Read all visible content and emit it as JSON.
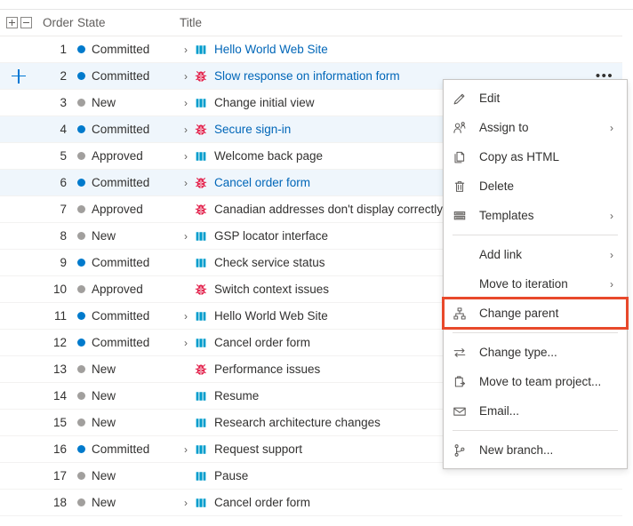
{
  "grid": {
    "columns": {
      "toggle_expand_label": "expand-all",
      "toggle_collapse_label": "collapse-all",
      "order": "Order",
      "state": "State",
      "title": "Title"
    },
    "more_glyph": "•••",
    "chevron_glyph": "›",
    "rows": [
      {
        "order": "1",
        "state": "Committed",
        "state_color": "#007acc",
        "chevron": true,
        "icon": "backlog-item-icon",
        "title": "Hello World Web Site",
        "link": true,
        "selected": false,
        "more": false,
        "addchild": false
      },
      {
        "order": "2",
        "state": "Committed",
        "state_color": "#007acc",
        "chevron": true,
        "icon": "bug-icon",
        "title": "Slow response on information form",
        "link": true,
        "selected": true,
        "more": true,
        "addchild": true
      },
      {
        "order": "3",
        "state": "New",
        "state_color": "#a19f9d",
        "chevron": true,
        "icon": "backlog-item-icon",
        "title": "Change initial view",
        "link": false,
        "selected": false,
        "more": false,
        "addchild": false
      },
      {
        "order": "4",
        "state": "Committed",
        "state_color": "#007acc",
        "chevron": true,
        "icon": "bug-icon",
        "title": "Secure sign-in",
        "link": true,
        "selected": true,
        "more": true,
        "addchild": false
      },
      {
        "order": "5",
        "state": "Approved",
        "state_color": "#a19f9d",
        "chevron": true,
        "icon": "backlog-item-icon",
        "title": "Welcome back page",
        "link": false,
        "selected": false,
        "more": false,
        "addchild": false
      },
      {
        "order": "6",
        "state": "Committed",
        "state_color": "#007acc",
        "chevron": true,
        "icon": "bug-icon",
        "title": "Cancel order form",
        "link": true,
        "selected": true,
        "more": true,
        "addchild": false
      },
      {
        "order": "7",
        "state": "Approved",
        "state_color": "#a19f9d",
        "chevron": false,
        "icon": "bug-icon",
        "title": "Canadian addresses don't display correctly",
        "link": false,
        "selected": false,
        "more": false,
        "addchild": false
      },
      {
        "order": "8",
        "state": "New",
        "state_color": "#a19f9d",
        "chevron": true,
        "icon": "backlog-item-icon",
        "title": "GSP locator interface",
        "link": false,
        "selected": false,
        "more": false,
        "addchild": false
      },
      {
        "order": "9",
        "state": "Committed",
        "state_color": "#007acc",
        "chevron": false,
        "icon": "backlog-item-icon",
        "title": "Check service status",
        "link": false,
        "selected": false,
        "more": false,
        "addchild": false
      },
      {
        "order": "10",
        "state": "Approved",
        "state_color": "#a19f9d",
        "chevron": false,
        "icon": "bug-icon",
        "title": "Switch context issues",
        "link": false,
        "selected": false,
        "more": false,
        "addchild": false
      },
      {
        "order": "11",
        "state": "Committed",
        "state_color": "#007acc",
        "chevron": true,
        "icon": "backlog-item-icon",
        "title": "Hello World Web Site",
        "link": false,
        "selected": false,
        "more": false,
        "addchild": false
      },
      {
        "order": "12",
        "state": "Committed",
        "state_color": "#007acc",
        "chevron": true,
        "icon": "backlog-item-icon",
        "title": "Cancel order form",
        "link": false,
        "selected": false,
        "more": false,
        "addchild": false
      },
      {
        "order": "13",
        "state": "New",
        "state_color": "#a19f9d",
        "chevron": false,
        "icon": "bug-icon",
        "title": "Performance issues",
        "link": false,
        "selected": false,
        "more": false,
        "addchild": false
      },
      {
        "order": "14",
        "state": "New",
        "state_color": "#a19f9d",
        "chevron": false,
        "icon": "backlog-item-icon",
        "title": "Resume",
        "link": false,
        "selected": false,
        "more": false,
        "addchild": false
      },
      {
        "order": "15",
        "state": "New",
        "state_color": "#a19f9d",
        "chevron": false,
        "icon": "backlog-item-icon",
        "title": "Research architecture changes",
        "link": false,
        "selected": false,
        "more": false,
        "addchild": false
      },
      {
        "order": "16",
        "state": "Committed",
        "state_color": "#007acc",
        "chevron": true,
        "icon": "backlog-item-icon",
        "title": "Request support",
        "link": false,
        "selected": false,
        "more": false,
        "addchild": false
      },
      {
        "order": "17",
        "state": "New",
        "state_color": "#a19f9d",
        "chevron": false,
        "icon": "backlog-item-icon",
        "title": "Pause",
        "link": false,
        "selected": false,
        "more": false,
        "addchild": false
      },
      {
        "order": "18",
        "state": "New",
        "state_color": "#a19f9d",
        "chevron": true,
        "icon": "backlog-item-icon",
        "title": "Cancel order form",
        "link": false,
        "selected": false,
        "more": false,
        "addchild": false
      }
    ]
  },
  "context_menu": {
    "submenu_glyph": "›",
    "highlight_color": "#e8492b",
    "items": [
      {
        "label": "Edit",
        "icon": "pencil-icon",
        "submenu": false,
        "highlight": false,
        "sep_after": false
      },
      {
        "label": "Assign to",
        "icon": "person-icon",
        "submenu": true,
        "highlight": false,
        "sep_after": false
      },
      {
        "label": "Copy as HTML",
        "icon": "copy-icon",
        "submenu": false,
        "highlight": false,
        "sep_after": false
      },
      {
        "label": "Delete",
        "icon": "trash-icon",
        "submenu": false,
        "highlight": false,
        "sep_after": false
      },
      {
        "label": "Templates",
        "icon": "templates-icon",
        "submenu": true,
        "highlight": false,
        "sep_after": true
      },
      {
        "label": "Add link",
        "icon": "none",
        "submenu": true,
        "highlight": false,
        "sep_after": false
      },
      {
        "label": "Move to iteration",
        "icon": "none",
        "submenu": true,
        "highlight": false,
        "sep_after": false
      },
      {
        "label": "Change parent",
        "icon": "hierarchy-icon",
        "submenu": false,
        "highlight": true,
        "sep_after": true
      },
      {
        "label": "Change type...",
        "icon": "swap-icon",
        "submenu": false,
        "highlight": false,
        "sep_after": false
      },
      {
        "label": "Move to team project...",
        "icon": "clipboard-arrow-icon",
        "submenu": false,
        "highlight": false,
        "sep_after": false
      },
      {
        "label": "Email...",
        "icon": "mail-icon",
        "submenu": false,
        "highlight": false,
        "sep_after": true
      },
      {
        "label": "New branch...",
        "icon": "branch-icon",
        "submenu": false,
        "highlight": false,
        "sep_after": false
      }
    ]
  }
}
